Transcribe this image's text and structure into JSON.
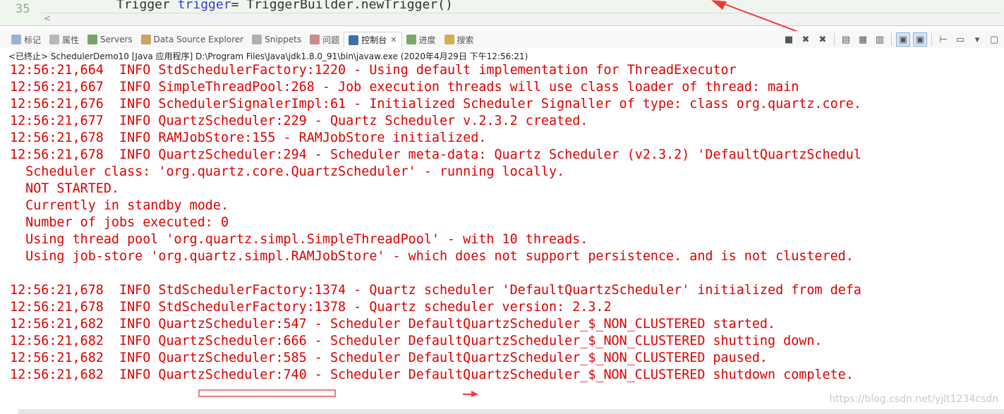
{
  "editor": {
    "line_number": "35",
    "code": {
      "type": "Trigger ",
      "var": "trigger",
      "rest": "= TriggerBuilder.newTrigger()"
    },
    "scroll_arrow": "<"
  },
  "tabs": [
    {
      "label": "标记",
      "name": "tab-markers",
      "color": "#9bb3cf"
    },
    {
      "label": "属性",
      "name": "tab-properties",
      "color": "#b8b8b8"
    },
    {
      "label": "Servers",
      "name": "tab-servers",
      "color": "#7aa36a"
    },
    {
      "label": "Data Source Explorer",
      "name": "tab-data-source-explorer",
      "color": "#c9a463"
    },
    {
      "label": "Snippets",
      "name": "tab-snippets",
      "color": "#b0b0b0"
    },
    {
      "label": "问题",
      "name": "tab-problems",
      "color": "#c98b8b"
    },
    {
      "label": "控制台",
      "name": "tab-console",
      "color": "#3b6ea8",
      "active": true,
      "close": "✕"
    },
    {
      "label": "进度",
      "name": "tab-progress",
      "color": "#7aa86a"
    },
    {
      "label": "搜索",
      "name": "tab-search",
      "color": "#d0b050"
    }
  ],
  "toolbar": [
    {
      "name": "stop-icon",
      "glyph": "■"
    },
    {
      "name": "remove-launch-icon",
      "glyph": "✖"
    },
    {
      "name": "remove-all-icon",
      "glyph": "✖"
    },
    {
      "name": "clear-console-icon",
      "glyph": "▤"
    },
    {
      "name": "scroll-lock-icon",
      "glyph": "▦"
    },
    {
      "name": "word-wrap-icon",
      "glyph": "▥"
    },
    {
      "name": "show-on-stdout-icon",
      "glyph": "▣",
      "selected": true
    },
    {
      "name": "show-on-stderr-icon",
      "glyph": "▣",
      "selected": true
    },
    {
      "name": "pin-console-icon",
      "glyph": "⊢"
    },
    {
      "name": "display-console-icon",
      "glyph": "▭"
    },
    {
      "name": "dropdown-icon",
      "glyph": "▾"
    },
    {
      "name": "new-console-icon",
      "glyph": "▢"
    }
  ],
  "process_line": "<已终止> SchedulerDemo10 [Java 应用程序] D:\\Program Files\\Java\\jdk1.8.0_91\\bin\\javaw.exe (2020年4月29日 下午12:56:21)",
  "console_lines": [
    "12:56:21,664  INFO StdSchedulerFactory:1220 - Using default implementation for ThreadExecutor",
    "12:56:21,667  INFO SimpleThreadPool:268 - Job execution threads will use class loader of thread: main",
    "12:56:21,676  INFO SchedulerSignalerImpl:61 - Initialized Scheduler Signaller of type: class org.quartz.core.",
    "12:56:21,677  INFO QuartzScheduler:229 - Quartz Scheduler v.2.3.2 created.",
    "12:56:21,678  INFO RAMJobStore:155 - RAMJobStore initialized.",
    "12:56:21,678  INFO QuartzScheduler:294 - Scheduler meta-data: Quartz Scheduler (v2.3.2) 'DefaultQuartzSchedul",
    "  Scheduler class: 'org.quartz.core.QuartzScheduler' - running locally.",
    "  NOT STARTED.",
    "  Currently in standby mode.",
    "  Number of jobs executed: 0",
    "  Using thread pool 'org.quartz.simpl.SimpleThreadPool' - with 10 threads.",
    "  Using job-store 'org.quartz.simpl.RAMJobStore' - which does not support persistence. and is not clustered.",
    "",
    "12:56:21,678  INFO StdSchedulerFactory:1374 - Quartz scheduler 'DefaultQuartzScheduler' initialized from defa",
    "12:56:21,678  INFO StdSchedulerFactory:1378 - Quartz scheduler version: 2.3.2",
    "12:56:21,682  INFO QuartzScheduler:547 - Scheduler DefaultQuartzScheduler_$_NON_CLUSTERED started.",
    "12:56:21,682  INFO QuartzScheduler:666 - Scheduler DefaultQuartzScheduler_$_NON_CLUSTERED shutting down.",
    "12:56:21,682  INFO QuartzScheduler:585 - Scheduler DefaultQuartzScheduler_$_NON_CLUSTERED paused.",
    "12:56:21,682  INFO QuartzScheduler:740 - Scheduler DefaultQuartzScheduler_$_NON_CLUSTERED shutdown complete."
  ],
  "watermark": "https://blog.csdn.net/yjlt1234csdn",
  "colors": {
    "console_text": "#dd0000",
    "annotation": "#ef3b3b"
  }
}
